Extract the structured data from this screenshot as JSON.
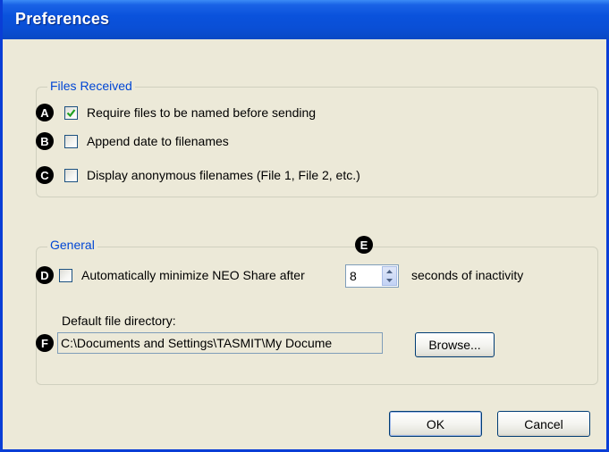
{
  "window": {
    "title": "Preferences"
  },
  "files_received": {
    "legend": "Files Received",
    "items": [
      {
        "badge": "A",
        "label": "Require files to be named before sending",
        "checked": true
      },
      {
        "badge": "B",
        "label": "Append date to filenames",
        "checked": false
      },
      {
        "badge": "C",
        "label": "Display anonymous filenames (File 1, File 2, etc.)",
        "checked": false
      }
    ]
  },
  "general": {
    "legend": "General",
    "minimize": {
      "badge": "D",
      "label": "Automatically minimize NEO Share after",
      "checked": false,
      "seconds_badge": "E",
      "seconds_value": "8",
      "suffix": "seconds of inactivity"
    },
    "directory": {
      "label": "Default file directory:",
      "badge": "F",
      "value": "C:\\Documents and Settings\\TASMIT\\My Docume",
      "browse_label": "Browse..."
    }
  },
  "buttons": {
    "ok": "OK",
    "cancel": "Cancel"
  },
  "colors": {
    "titlebar": "#0a52dc",
    "dialog": "#ece9d8",
    "legend": "#0046d5",
    "check": "#21a121"
  }
}
